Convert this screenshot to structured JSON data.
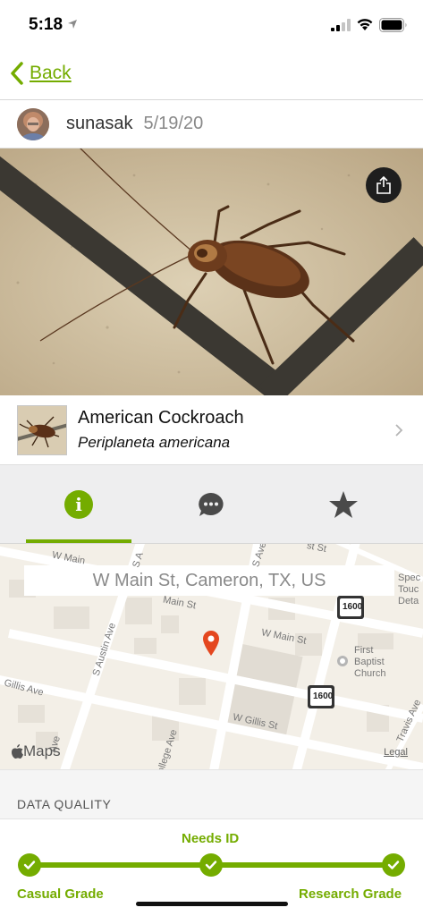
{
  "status_bar": {
    "time": "5:18"
  },
  "nav": {
    "back_label": "Back"
  },
  "observer": {
    "username": "sunasak",
    "date": "5/19/20"
  },
  "taxon": {
    "common_name": "American Cockroach",
    "scientific_name": "Periplaneta americana"
  },
  "tabs": [
    {
      "name": "info",
      "icon": "info-icon",
      "active": true
    },
    {
      "name": "comments",
      "icon": "comments-icon",
      "active": false
    },
    {
      "name": "favorites",
      "icon": "star-icon",
      "active": false
    }
  ],
  "map": {
    "address": "W Main St, Cameron, TX, US",
    "labels": {
      "w_main_top": "W Main",
      "s_a": "S A",
      "s_ave": "S Ave",
      "st_st": "st St",
      "main_st": "Main St",
      "w_main_st": "W Main St",
      "s_austin_ave": "S Austin Ave",
      "w_gillis_ave": "Gillis Ave",
      "w_gillis_st": "W Gillis St",
      "college_ave": "ollege Ave",
      "travis_ave": "Travis Ave",
      "first_baptist": "First",
      "baptist": "Baptist",
      "church": "Church",
      "spec": "Spec",
      "touch": "Touc",
      "deta": "Deta",
      "ave_left": "Ave",
      "highway": "1600"
    },
    "logo": "Maps",
    "legal": "Legal"
  },
  "data_quality": {
    "title": "DATA QUALITY",
    "needs_id": "Needs ID",
    "casual": "Casual Grade",
    "research": "Research Grade"
  },
  "colors": {
    "accent": "#74ac00",
    "pin": "#e4471f"
  }
}
